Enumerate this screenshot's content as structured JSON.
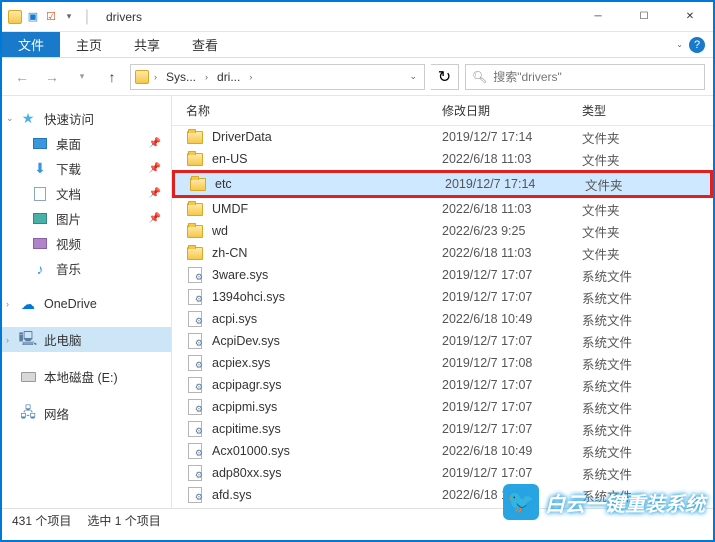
{
  "window": {
    "title": "drivers"
  },
  "ribbon": {
    "file": "文件",
    "home": "主页",
    "share": "共享",
    "view": "查看"
  },
  "breadcrumb": {
    "seg1": "Sys...",
    "seg2": "dri...",
    "refresh_dropdown": "⌄"
  },
  "search": {
    "placeholder": "搜索\"drivers\""
  },
  "nav": {
    "quick_access": "快速访问",
    "desktop": "桌面",
    "downloads": "下载",
    "documents": "文档",
    "pictures": "图片",
    "videos": "视频",
    "music": "音乐",
    "onedrive": "OneDrive",
    "this_pc": "此电脑",
    "local_disk": "本地磁盘 (E:)",
    "network": "网络"
  },
  "columns": {
    "name": "名称",
    "date": "修改日期",
    "type": "类型"
  },
  "type_labels": {
    "folder": "文件夹",
    "sysfile": "系统文件"
  },
  "files": [
    {
      "name": "DriverData",
      "date": "2019/12/7 17:14",
      "kind": "folder"
    },
    {
      "name": "en-US",
      "date": "2022/6/18 11:03",
      "kind": "folder"
    },
    {
      "name": "etc",
      "date": "2019/12/7 17:14",
      "kind": "folder",
      "selected": true,
      "highlighted": true
    },
    {
      "name": "UMDF",
      "date": "2022/6/18 11:03",
      "kind": "folder"
    },
    {
      "name": "wd",
      "date": "2022/6/23 9:25",
      "kind": "folder"
    },
    {
      "name": "zh-CN",
      "date": "2022/6/18 11:03",
      "kind": "folder"
    },
    {
      "name": "3ware.sys",
      "date": "2019/12/7 17:07",
      "kind": "sysfile"
    },
    {
      "name": "1394ohci.sys",
      "date": "2019/12/7 17:07",
      "kind": "sysfile"
    },
    {
      "name": "acpi.sys",
      "date": "2022/6/18 10:49",
      "kind": "sysfile"
    },
    {
      "name": "AcpiDev.sys",
      "date": "2019/12/7 17:07",
      "kind": "sysfile"
    },
    {
      "name": "acpiex.sys",
      "date": "2019/12/7 17:08",
      "kind": "sysfile"
    },
    {
      "name": "acpipagr.sys",
      "date": "2019/12/7 17:07",
      "kind": "sysfile"
    },
    {
      "name": "acpipmi.sys",
      "date": "2019/12/7 17:07",
      "kind": "sysfile"
    },
    {
      "name": "acpitime.sys",
      "date": "2019/12/7 17:07",
      "kind": "sysfile"
    },
    {
      "name": "Acx01000.sys",
      "date": "2022/6/18 10:49",
      "kind": "sysfile"
    },
    {
      "name": "adp80xx.sys",
      "date": "2019/12/7 17:07",
      "kind": "sysfile"
    },
    {
      "name": "afd.sys",
      "date": "2022/6/18 10:49",
      "kind": "sysfile"
    }
  ],
  "status": {
    "count": "431 个项目",
    "selection": "选中 1 个项目"
  },
  "watermark": {
    "text": "白云一键重装系统"
  }
}
